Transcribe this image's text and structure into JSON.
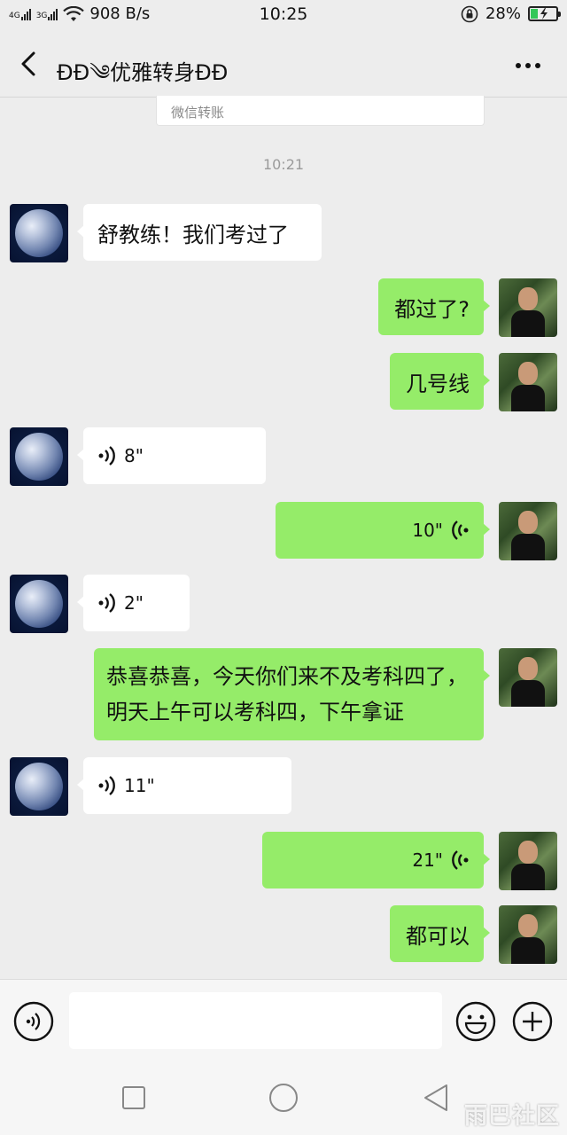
{
  "status_bar": {
    "net1": "4G",
    "net2": "3G",
    "speed": "908 B/s",
    "time": "10:25",
    "battery": "28%",
    "battery_level": 0.28
  },
  "header": {
    "back_icon": "chevron-left-icon",
    "title": "ƉƉ༄优雅转身ƉƉ",
    "more_icon": "more-icon"
  },
  "transfer_card": {
    "label": "微信转账"
  },
  "timestamp": "10:21",
  "messages": [
    {
      "side": "in",
      "text": "舒教练！我们考过了"
    },
    {
      "side": "out",
      "text": "都过了?"
    },
    {
      "side": "out",
      "text": "几号线"
    },
    {
      "side": "in",
      "voice": "8\""
    },
    {
      "side": "out",
      "voice": "10\""
    },
    {
      "side": "in",
      "voice": "2\""
    },
    {
      "side": "out",
      "text": "恭喜恭喜，今天你们来不及考科四了，明天上午可以考科四，下午拿证"
    },
    {
      "side": "in",
      "voice": "11\""
    },
    {
      "side": "out",
      "voice": "21\""
    },
    {
      "side": "out",
      "text": "都可以"
    }
  ],
  "input_bar": {
    "voice_icon": "voice-input-icon",
    "input_value": "",
    "emoji_icon": "emoji-icon",
    "plus_icon": "plus-icon"
  },
  "nav_bar": {
    "icons": [
      "recents-square-icon",
      "home-circle-icon",
      "back-triangle-icon"
    ],
    "watermark": "雨巴社区"
  },
  "colors": {
    "background": "#ededed",
    "incoming_bubble": "#ffffff",
    "outgoing_bubble": "#95ec69"
  }
}
